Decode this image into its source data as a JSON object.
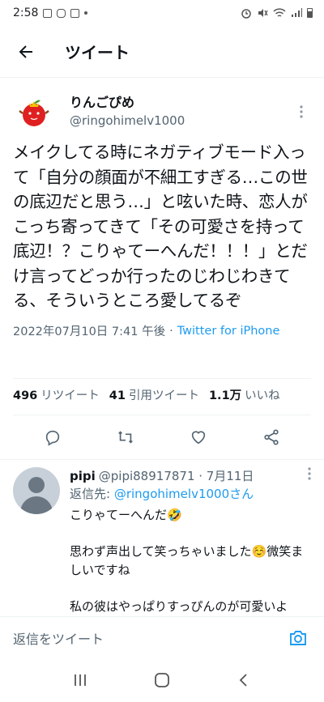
{
  "status_bar": {
    "time": "2:58"
  },
  "header": {
    "title": "ツイート"
  },
  "tweet": {
    "display_name": "りんごぴめ",
    "handle": "@ringohimelv1000",
    "text": "メイクしてる時にネガティブモード入って「自分の顔面が不細工すぎる…この世の底辺だと思う…」と呟いた時、恋人がこっち寄ってきて「その可愛さを持って底辺！？こりゃてーへんだ！！！」とだけ言ってどっか行ったのじわじわきてる、そういうところ愛してるぞ",
    "timestamp": "2022年07月10日 7:41 午後",
    "separator": "·",
    "source": "Twitter for iPhone"
  },
  "stats": {
    "retweets_count": "496",
    "retweets_label": "リツイート",
    "quotes_count": "41",
    "quotes_label": "引用ツイート",
    "likes_count": "1.1万",
    "likes_label": "いいね"
  },
  "reply": {
    "name": "pipi",
    "handle": "@pipi88917871 · 7月11日",
    "reply_to_label": "返信先:",
    "reply_to_mention": "@ringohimelv1000さん",
    "line1": "こりゃてーへんだ🤣",
    "line2": "思わず声出して笑っちゃいました☺️微笑ましいですね",
    "line3": "私の彼はやっぱりすっぴんのが可愛いよ"
  },
  "composer": {
    "placeholder": "返信をツイート"
  },
  "colors": {
    "accent": "#1d9bf0",
    "text": "#0f1419",
    "muted": "#536471"
  }
}
